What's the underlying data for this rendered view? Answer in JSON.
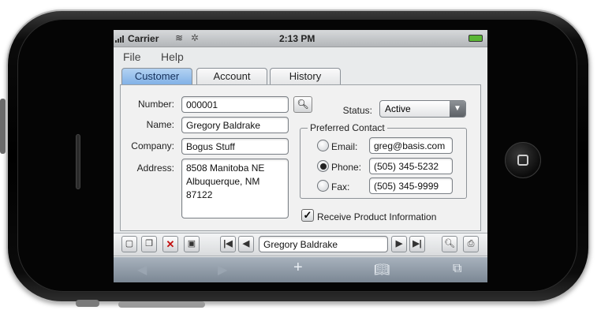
{
  "status_bar": {
    "carrier": "Carrier",
    "time": "2:13 PM"
  },
  "menu": {
    "file": "File",
    "help": "Help"
  },
  "tabs": [
    {
      "label": "Customer",
      "active": true
    },
    {
      "label": "Account",
      "active": false
    },
    {
      "label": "History",
      "active": false
    }
  ],
  "form": {
    "number_label": "Number:",
    "number_value": "000001",
    "name_label": "Name:",
    "name_value": "Gregory Baldrake",
    "company_label": "Company:",
    "company_value": "Bogus Stuff",
    "address_label": "Address:",
    "address_value": "8508 Manitoba NE\nAlbuquerque, NM\n87122",
    "status_label": "Status:",
    "status_value": "Active",
    "preferred_contact_title": "Preferred Contact",
    "contact_options": [
      {
        "label": "Email:",
        "value": "greg@basis.com",
        "selected": false
      },
      {
        "label": "Phone:",
        "value": "(505) 345-5232",
        "selected": true
      },
      {
        "label": "Fax:",
        "value": "(505) 345-9999",
        "selected": false
      }
    ],
    "receive_info_label": "Receive Product Information",
    "receive_info_checked": true
  },
  "toolbar": {
    "nav_value": "Gregory Baldrake"
  },
  "icons": {
    "signal": "signal-icon",
    "wifi": "wifi-icon",
    "battery": "battery-icon",
    "search": "search-icon",
    "new": "new-document-icon",
    "copy": "copy-icon",
    "delete": "delete-icon",
    "save": "save-icon",
    "first": "first-record-icon",
    "prev": "previous-record-icon",
    "next": "next-record-icon",
    "last": "last-record-icon",
    "find": "find-icon",
    "print": "print-icon",
    "safari_back": "back-arrow-icon",
    "safari_forward": "forward-arrow-icon",
    "safari_add": "plus-icon",
    "safari_bookmarks": "bookmarks-icon",
    "safari_pages": "pages-icon"
  },
  "colors": {
    "active_tab": "#7fb0e6",
    "battery": "#5ab634",
    "delete": "#c21010"
  }
}
